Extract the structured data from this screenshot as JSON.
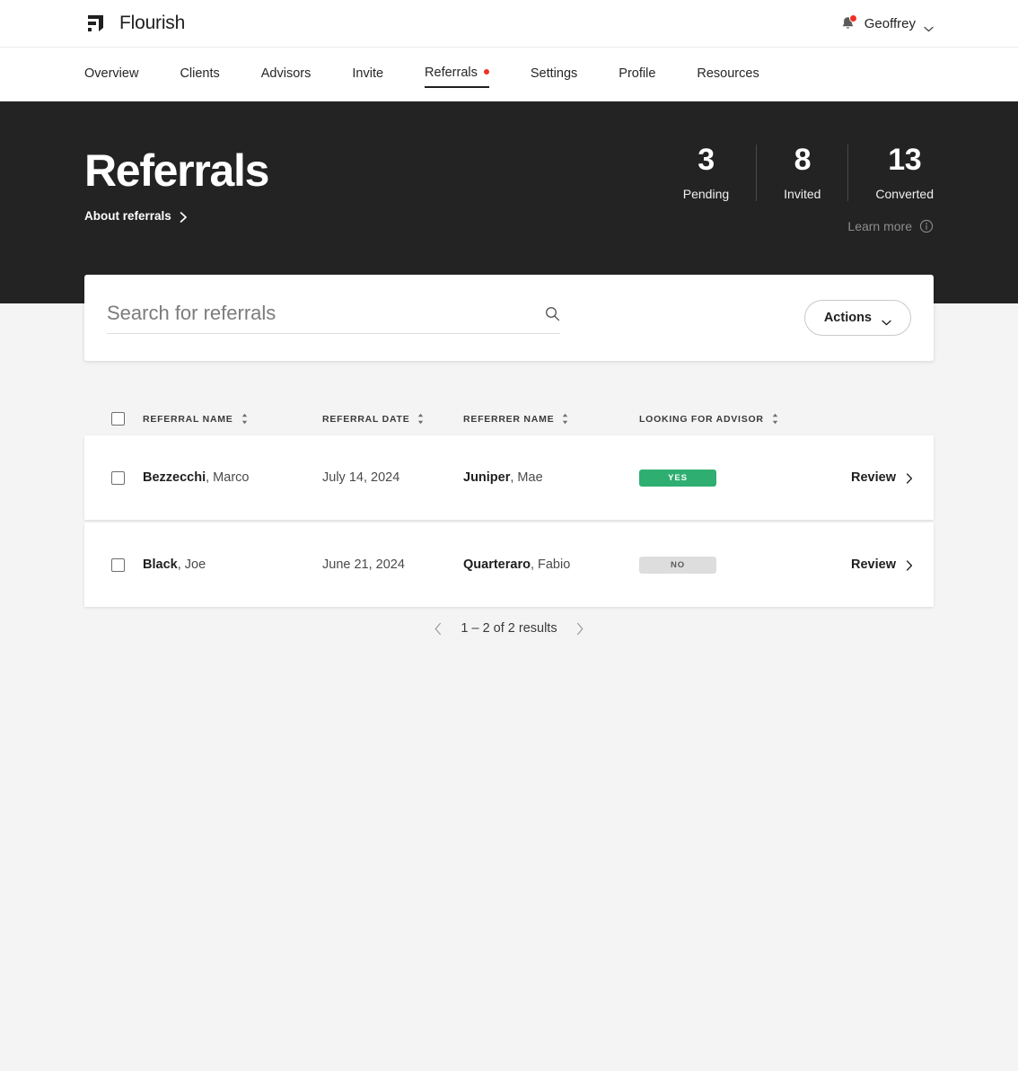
{
  "brand": {
    "name": "Flourish",
    "logo_icon": "flourish-logo-icon"
  },
  "header": {
    "bell_icon": "notification-bell-icon",
    "account_name": "Geoffrey",
    "caret_icon": "chevron-down-icon"
  },
  "nav": {
    "items": [
      {
        "label": "Overview",
        "active": false,
        "dot": false
      },
      {
        "label": "Clients",
        "active": false,
        "dot": false
      },
      {
        "label": "Advisors",
        "active": false,
        "dot": false
      },
      {
        "label": "Invite",
        "active": false,
        "dot": false
      },
      {
        "label": "Referrals",
        "active": true,
        "dot": true
      },
      {
        "label": "Settings",
        "active": false,
        "dot": false
      },
      {
        "label": "Profile",
        "active": false,
        "dot": false
      },
      {
        "label": "Resources",
        "active": false,
        "dot": false
      }
    ]
  },
  "hero": {
    "title": "Referrals",
    "about_link": "About referrals",
    "about_icon": "chevron-right-icon",
    "stats": [
      {
        "value": "3",
        "label": "Pending"
      },
      {
        "value": "8",
        "label": "Invited"
      },
      {
        "value": "13",
        "label": "Converted"
      }
    ],
    "learn_more": "Learn more",
    "learn_more_icon": "info-circle-icon",
    "background_color": "#232323"
  },
  "search": {
    "placeholder": "Search for referrals",
    "value": "",
    "icon": "search-icon",
    "actions_label": "Actions",
    "actions_icon": "chevron-down-icon"
  },
  "table": {
    "columns": [
      {
        "label": "REFERRAL NAME",
        "sort_icon": "sort-updown-icon"
      },
      {
        "label": "REFERRAL DATE",
        "sort_icon": "sort-updown-icon"
      },
      {
        "label": "REFERRER NAME",
        "sort_icon": "sort-updown-icon"
      },
      {
        "label": "LOOKING FOR ADVISOR",
        "sort_icon": "sort-updown-icon"
      }
    ],
    "rows": [
      {
        "last_name": "Bezzecchi",
        "first_name": ", Marco",
        "date": "July 14, 2024",
        "referrer_last": "Juniper",
        "referrer_first": ", Mae",
        "looking": "YES",
        "looking_state": "yes",
        "action": "Review"
      },
      {
        "last_name": "Black",
        "first_name": ", Joe",
        "date": "June 21, 2024",
        "referrer_last": "Quarteraro",
        "referrer_first": ", Fabio",
        "looking": "NO",
        "looking_state": "no",
        "action": "Review"
      }
    ]
  },
  "pagination": {
    "prev_icon": "chevron-left-icon",
    "text": "1 – 2 of 2 results",
    "next_icon": "chevron-right-icon"
  },
  "colors": {
    "accent_green": "#2eaf71",
    "accent_red": "#ee3124",
    "hero_dark": "#232323",
    "page_bg": "#f4f4f4"
  }
}
